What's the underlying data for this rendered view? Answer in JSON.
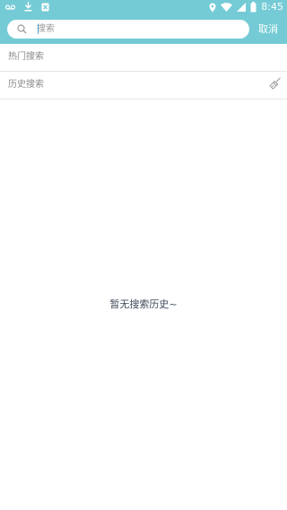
{
  "status_bar": {
    "time": "8:45",
    "icons": [
      "voicemail-icon",
      "download-icon",
      "close-box-icon",
      "location-icon",
      "wifi-icon",
      "signal-icon",
      "battery-icon"
    ]
  },
  "header": {
    "background_color": "#74cbd5"
  },
  "search": {
    "placeholder": "搜索",
    "value": "",
    "cancel_label": "取消"
  },
  "sections": {
    "hot_search_label": "热门搜索",
    "history_search_label": "历史搜索"
  },
  "empty_state": {
    "text": "暂无搜索历史~"
  }
}
